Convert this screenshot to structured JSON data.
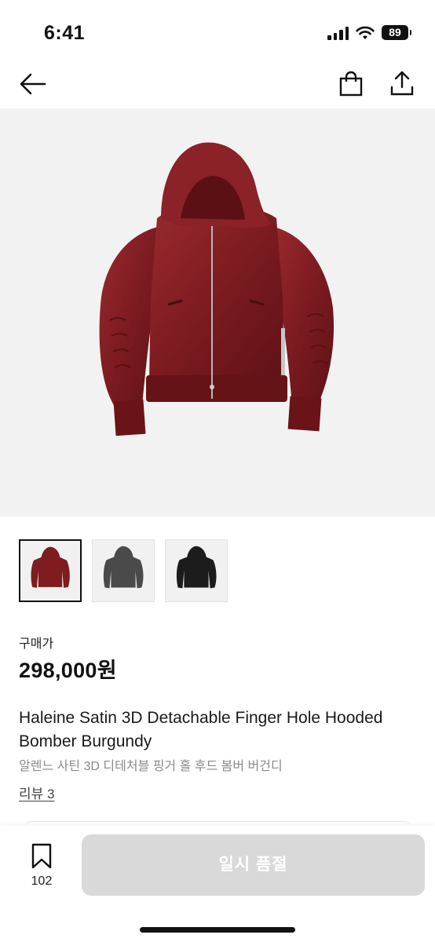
{
  "status_bar": {
    "time": "6:41",
    "battery": "89",
    "icons": [
      "cellular-signal-icon",
      "wifi-icon",
      "battery-icon"
    ]
  },
  "nav": {
    "icons": [
      "back-arrow-icon",
      "shopping-bag-icon",
      "share-icon"
    ]
  },
  "product": {
    "image_color": "#7e1c20",
    "thumbnails": [
      {
        "color": "#7e1c20",
        "selected": true
      },
      {
        "color": "#4a4a4a",
        "selected": false
      },
      {
        "color": "#1c1c1c",
        "selected": false
      }
    ],
    "price_label": "구매가",
    "price": "298,000원",
    "title_en": "Haleine Satin 3D Detachable Finger Hole Hooded Bomber Burgundy",
    "title_ko": "알렌느 사틴 3D 디테처블 핑거 홀 후드 봄버 버건디",
    "review_link": "리뷰 3"
  },
  "bottom_bar": {
    "bookmark_count": "102",
    "soldout_label": "일시 품절",
    "soldout_color": "#d9d9d9"
  }
}
